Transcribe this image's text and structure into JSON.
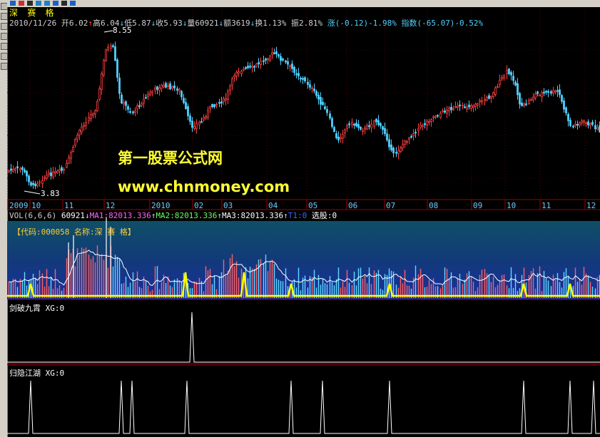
{
  "header": {
    "stock_name": "深 赛 格",
    "date": "2010/11/26",
    "open_label": "开",
    "open": "6.02",
    "high_label": "高",
    "high": "6.04",
    "low_label": "低",
    "low": "5.87",
    "close_label": "收",
    "close": "5.93",
    "vol_label": "量",
    "vol": "60921",
    "amount_label": "额",
    "amount": "3619",
    "turnover_label": "换",
    "turnover": "1.13%",
    "amplitude_label": "振",
    "amplitude": "2.81%",
    "change_label": "涨",
    "change": "(-0.12)-1.98%",
    "index_label": "指数",
    "index_change": "(-65.07)-0.52%"
  },
  "price_chart": {
    "max_label": "8.55",
    "min_label": "3.83",
    "x_labels": [
      "2009",
      "10",
      "11",
      "12",
      "2010",
      "02",
      "03",
      "04",
      "05",
      "06",
      "07",
      "08",
      "09",
      "10",
      "11",
      "12"
    ]
  },
  "watermark": {
    "line1": "第一股票公式网",
    "line2": "www.chnmoney.com"
  },
  "volume_panel": {
    "indicator": "VOL(6,6,6)",
    "vol": "60921",
    "ma1": "MA1:82013.336",
    "ma2": "MA2:82013.336",
    "ma3": "MA3:82013.336",
    "t1": "T1:0",
    "select": "选股:0",
    "code_line": "【代码:000058 名称:深 赛 格】"
  },
  "panel1": {
    "label": "剑破九霄 XG:0"
  },
  "panel2": {
    "label": "归隐江湖 XG:0"
  },
  "colors": {
    "up": "#ff4040",
    "down": "#50d0ff",
    "grid": "#a00000",
    "signal": "#ffff00"
  },
  "icons": [
    "toolbar-button-icon"
  ]
}
